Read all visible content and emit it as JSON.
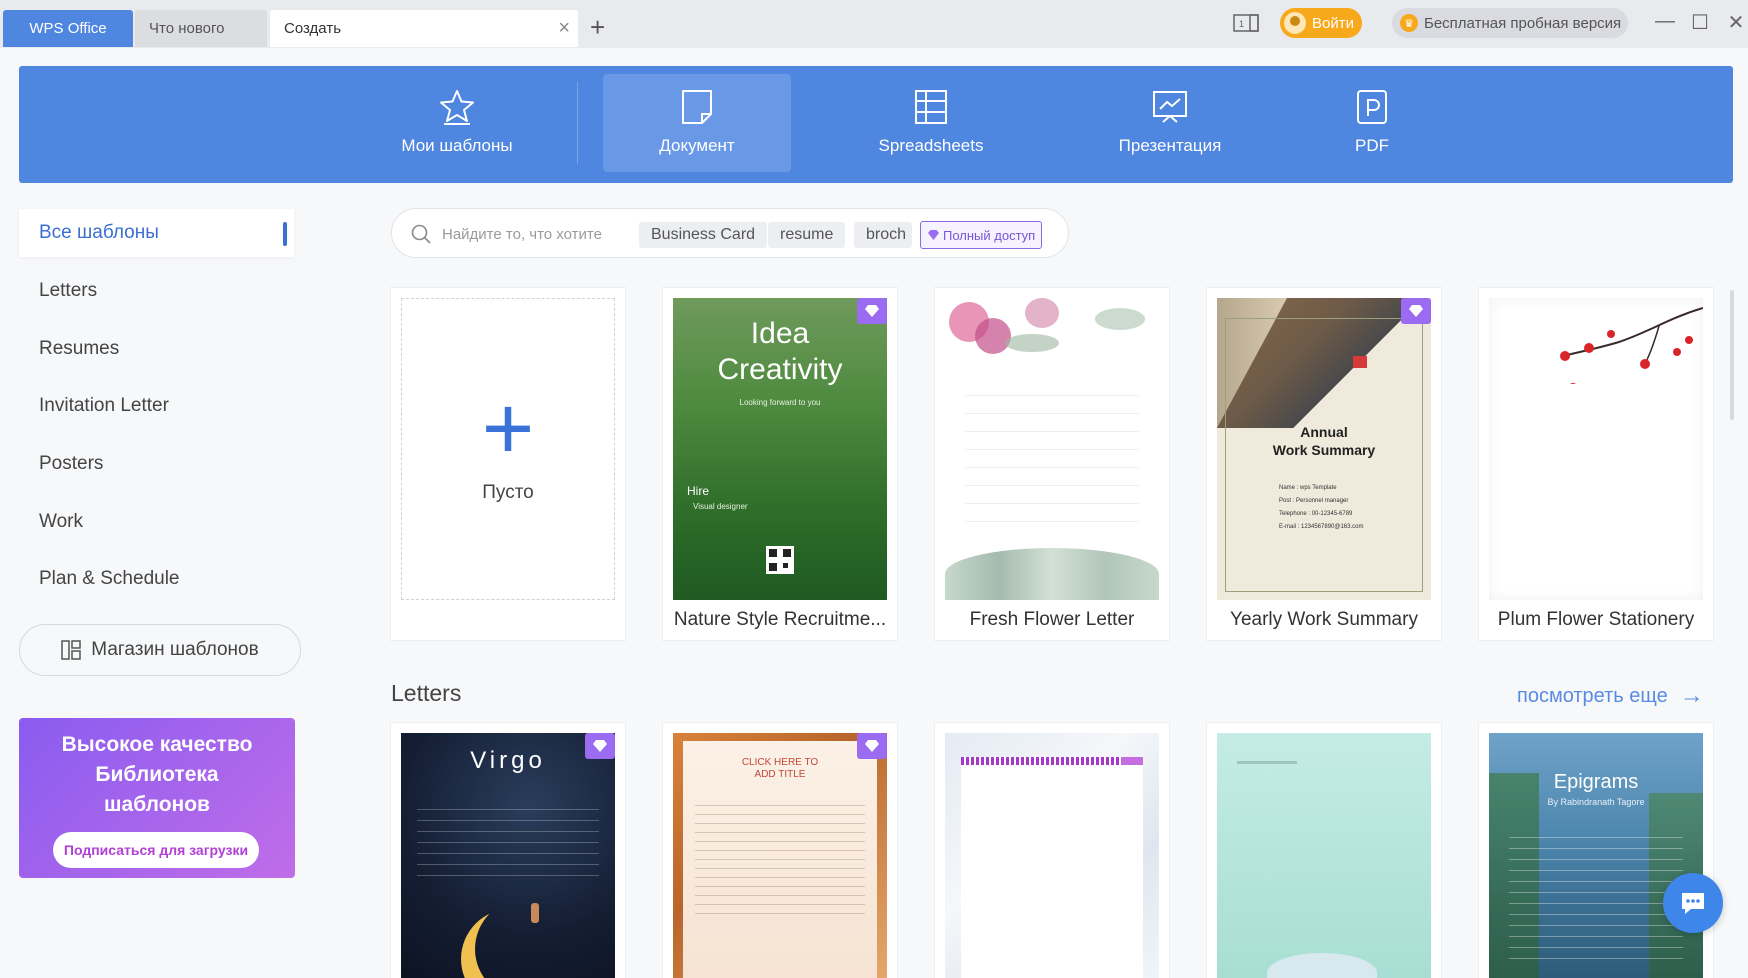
{
  "titlebar": {
    "tabs": [
      {
        "label": "WPS Office"
      },
      {
        "label": "Что нового"
      },
      {
        "label": "Создать"
      }
    ],
    "login_label": "Войти",
    "trial_label": "Бесплатная пробная версия"
  },
  "categories": [
    {
      "label": "Мои шаблоны",
      "icon": "star-icon"
    },
    {
      "label": "Документ",
      "icon": "document-icon",
      "active": true
    },
    {
      "label": "Spreadsheets",
      "icon": "spreadsheet-icon"
    },
    {
      "label": "Презентация",
      "icon": "presentation-icon"
    },
    {
      "label": "PDF",
      "icon": "pdf-icon"
    }
  ],
  "sidebar": {
    "items": [
      {
        "label": "Все шаблоны",
        "active": true
      },
      {
        "label": "Letters"
      },
      {
        "label": "Resumes"
      },
      {
        "label": "Invitation Letter"
      },
      {
        "label": "Posters"
      },
      {
        "label": "Work"
      },
      {
        "label": "Plan & Schedule"
      }
    ],
    "store_label": "Магазин шаблонов",
    "promo": {
      "line1": "Высокое качество",
      "line2": "Библиотека",
      "line3": "шаблонов",
      "button": "Подписаться для загрузки"
    }
  },
  "search": {
    "placeholder": "Найдите то, что хотите",
    "chips": [
      "Business Card",
      "resume",
      "broch"
    ],
    "access_label": "Полный доступ"
  },
  "featured": {
    "blank_label": "Пусто",
    "cards": [
      {
        "name": "Nature Style Recruitme...",
        "premium": true,
        "thumb_text": [
          "Idea",
          "Creativity",
          "Looking forward to you",
          "Hire",
          "Visual designer"
        ]
      },
      {
        "name": "Fresh Flower Letter",
        "premium": false
      },
      {
        "name": "Yearly Work Summary",
        "premium": true,
        "thumb_text": [
          "Annual",
          "Work Summary",
          "Name : wps Template",
          "Post : Personnel manager",
          "Telephone : 00-12345-6789",
          "E-mail : 1234567890@163.com"
        ]
      },
      {
        "name": "Plum Flower Stationery",
        "premium": false
      }
    ]
  },
  "letters": {
    "title": "Letters",
    "more_label": "посмотреть еще",
    "cards": [
      {
        "premium": true,
        "thumb_text": [
          "Virgo"
        ]
      },
      {
        "premium": true,
        "thumb_text": [
          "CLICK HERE TO",
          "ADD TITLE"
        ]
      },
      {
        "premium": false
      },
      {
        "premium": false
      },
      {
        "premium": false,
        "thumb_text": [
          "Epigrams",
          "By Rabindranath Tagore"
        ]
      }
    ]
  },
  "colors": {
    "brand_blue": "#4f86e0",
    "accent_orange": "#f7a81b",
    "premium_purple": "#9b6cf2"
  }
}
